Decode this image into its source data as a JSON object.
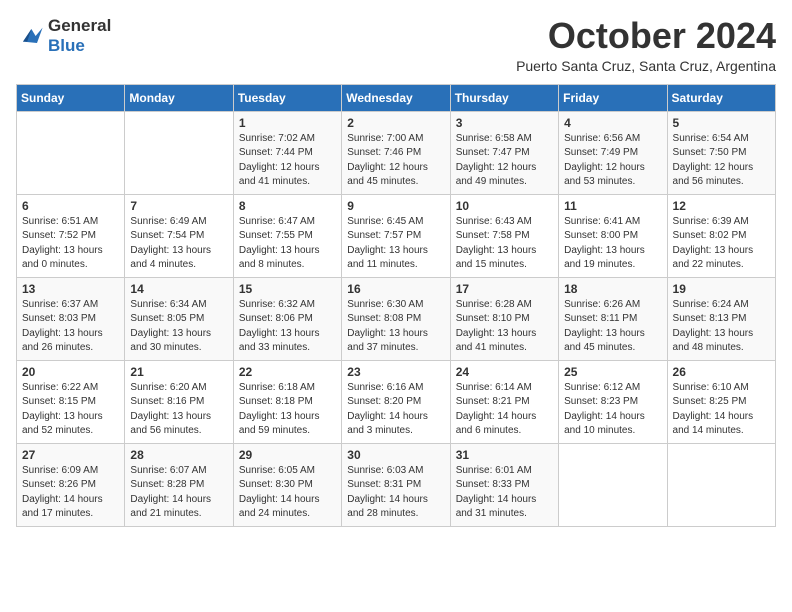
{
  "logo": {
    "line1": "General",
    "line2": "Blue"
  },
  "title": "October 2024",
  "subtitle": "Puerto Santa Cruz, Santa Cruz, Argentina",
  "weekdays": [
    "Sunday",
    "Monday",
    "Tuesday",
    "Wednesday",
    "Thursday",
    "Friday",
    "Saturday"
  ],
  "weeks": [
    [
      {
        "day": "",
        "info": ""
      },
      {
        "day": "",
        "info": ""
      },
      {
        "day": "1",
        "info": "Sunrise: 7:02 AM\nSunset: 7:44 PM\nDaylight: 12 hours\nand 41 minutes."
      },
      {
        "day": "2",
        "info": "Sunrise: 7:00 AM\nSunset: 7:46 PM\nDaylight: 12 hours\nand 45 minutes."
      },
      {
        "day": "3",
        "info": "Sunrise: 6:58 AM\nSunset: 7:47 PM\nDaylight: 12 hours\nand 49 minutes."
      },
      {
        "day": "4",
        "info": "Sunrise: 6:56 AM\nSunset: 7:49 PM\nDaylight: 12 hours\nand 53 minutes."
      },
      {
        "day": "5",
        "info": "Sunrise: 6:54 AM\nSunset: 7:50 PM\nDaylight: 12 hours\nand 56 minutes."
      }
    ],
    [
      {
        "day": "6",
        "info": "Sunrise: 6:51 AM\nSunset: 7:52 PM\nDaylight: 13 hours\nand 0 minutes."
      },
      {
        "day": "7",
        "info": "Sunrise: 6:49 AM\nSunset: 7:54 PM\nDaylight: 13 hours\nand 4 minutes."
      },
      {
        "day": "8",
        "info": "Sunrise: 6:47 AM\nSunset: 7:55 PM\nDaylight: 13 hours\nand 8 minutes."
      },
      {
        "day": "9",
        "info": "Sunrise: 6:45 AM\nSunset: 7:57 PM\nDaylight: 13 hours\nand 11 minutes."
      },
      {
        "day": "10",
        "info": "Sunrise: 6:43 AM\nSunset: 7:58 PM\nDaylight: 13 hours\nand 15 minutes."
      },
      {
        "day": "11",
        "info": "Sunrise: 6:41 AM\nSunset: 8:00 PM\nDaylight: 13 hours\nand 19 minutes."
      },
      {
        "day": "12",
        "info": "Sunrise: 6:39 AM\nSunset: 8:02 PM\nDaylight: 13 hours\nand 22 minutes."
      }
    ],
    [
      {
        "day": "13",
        "info": "Sunrise: 6:37 AM\nSunset: 8:03 PM\nDaylight: 13 hours\nand 26 minutes."
      },
      {
        "day": "14",
        "info": "Sunrise: 6:34 AM\nSunset: 8:05 PM\nDaylight: 13 hours\nand 30 minutes."
      },
      {
        "day": "15",
        "info": "Sunrise: 6:32 AM\nSunset: 8:06 PM\nDaylight: 13 hours\nand 33 minutes."
      },
      {
        "day": "16",
        "info": "Sunrise: 6:30 AM\nSunset: 8:08 PM\nDaylight: 13 hours\nand 37 minutes."
      },
      {
        "day": "17",
        "info": "Sunrise: 6:28 AM\nSunset: 8:10 PM\nDaylight: 13 hours\nand 41 minutes."
      },
      {
        "day": "18",
        "info": "Sunrise: 6:26 AM\nSunset: 8:11 PM\nDaylight: 13 hours\nand 45 minutes."
      },
      {
        "day": "19",
        "info": "Sunrise: 6:24 AM\nSunset: 8:13 PM\nDaylight: 13 hours\nand 48 minutes."
      }
    ],
    [
      {
        "day": "20",
        "info": "Sunrise: 6:22 AM\nSunset: 8:15 PM\nDaylight: 13 hours\nand 52 minutes."
      },
      {
        "day": "21",
        "info": "Sunrise: 6:20 AM\nSunset: 8:16 PM\nDaylight: 13 hours\nand 56 minutes."
      },
      {
        "day": "22",
        "info": "Sunrise: 6:18 AM\nSunset: 8:18 PM\nDaylight: 13 hours\nand 59 minutes."
      },
      {
        "day": "23",
        "info": "Sunrise: 6:16 AM\nSunset: 8:20 PM\nDaylight: 14 hours\nand 3 minutes."
      },
      {
        "day": "24",
        "info": "Sunrise: 6:14 AM\nSunset: 8:21 PM\nDaylight: 14 hours\nand 6 minutes."
      },
      {
        "day": "25",
        "info": "Sunrise: 6:12 AM\nSunset: 8:23 PM\nDaylight: 14 hours\nand 10 minutes."
      },
      {
        "day": "26",
        "info": "Sunrise: 6:10 AM\nSunset: 8:25 PM\nDaylight: 14 hours\nand 14 minutes."
      }
    ],
    [
      {
        "day": "27",
        "info": "Sunrise: 6:09 AM\nSunset: 8:26 PM\nDaylight: 14 hours\nand 17 minutes."
      },
      {
        "day": "28",
        "info": "Sunrise: 6:07 AM\nSunset: 8:28 PM\nDaylight: 14 hours\nand 21 minutes."
      },
      {
        "day": "29",
        "info": "Sunrise: 6:05 AM\nSunset: 8:30 PM\nDaylight: 14 hours\nand 24 minutes."
      },
      {
        "day": "30",
        "info": "Sunrise: 6:03 AM\nSunset: 8:31 PM\nDaylight: 14 hours\nand 28 minutes."
      },
      {
        "day": "31",
        "info": "Sunrise: 6:01 AM\nSunset: 8:33 PM\nDaylight: 14 hours\nand 31 minutes."
      },
      {
        "day": "",
        "info": ""
      },
      {
        "day": "",
        "info": ""
      }
    ]
  ]
}
